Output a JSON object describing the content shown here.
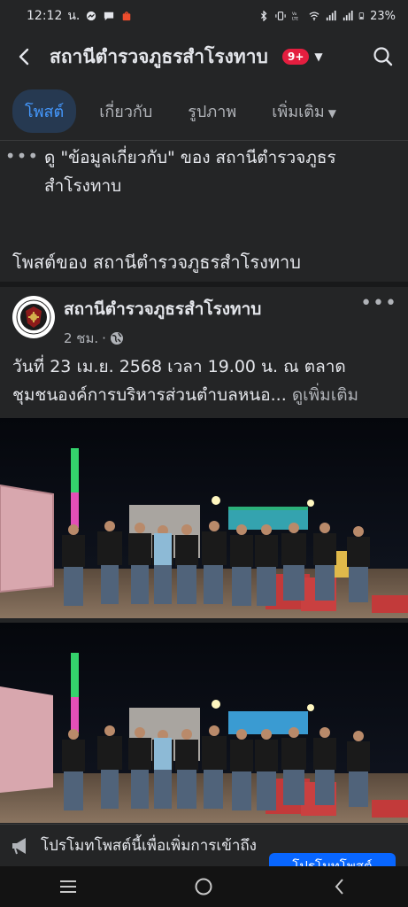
{
  "status_bar": {
    "time": "12:12",
    "time_suffix": "น.",
    "battery": "23%"
  },
  "header": {
    "title": "สถานีตำรวจภูธรสำโรงทาบ",
    "badge": "9+"
  },
  "tabs": [
    {
      "label": "โพสต์",
      "active": true
    },
    {
      "label": "เกี่ยวกับ",
      "active": false
    },
    {
      "label": "รูปภาพ",
      "active": false
    },
    {
      "label": "เพิ่มเติม",
      "active": false
    }
  ],
  "info": {
    "text": "ดู \"ข้อมูลเกี่ยวกับ\" ของ สถานีตำรวจภูธรสำโรงทาบ"
  },
  "section": {
    "title": "โพสต์ของ สถานีตำรวจภูธรสำโรงทาบ"
  },
  "post": {
    "author": "สถานีตำรวจภูธรสำโรงทาบ",
    "time": "2 ชม.",
    "body_line1": "วันที่ 23 เม.ย. 2568 เวลา 19.00 น. ณ ตลาด",
    "body_line2": "ชุมชนองค์การบริหารส่วนตำบลหนอ...",
    "see_more": "ดูเพิ่มเติม"
  },
  "promo": {
    "text": "โปรโมทโพสต์นี้เพื่อเพิ่มการเข้าถึง",
    "button": "โปรโมทโพสต์"
  },
  "colors": {
    "accent": "#4599ff",
    "badge": "#e41e3f",
    "background": "#242526"
  }
}
